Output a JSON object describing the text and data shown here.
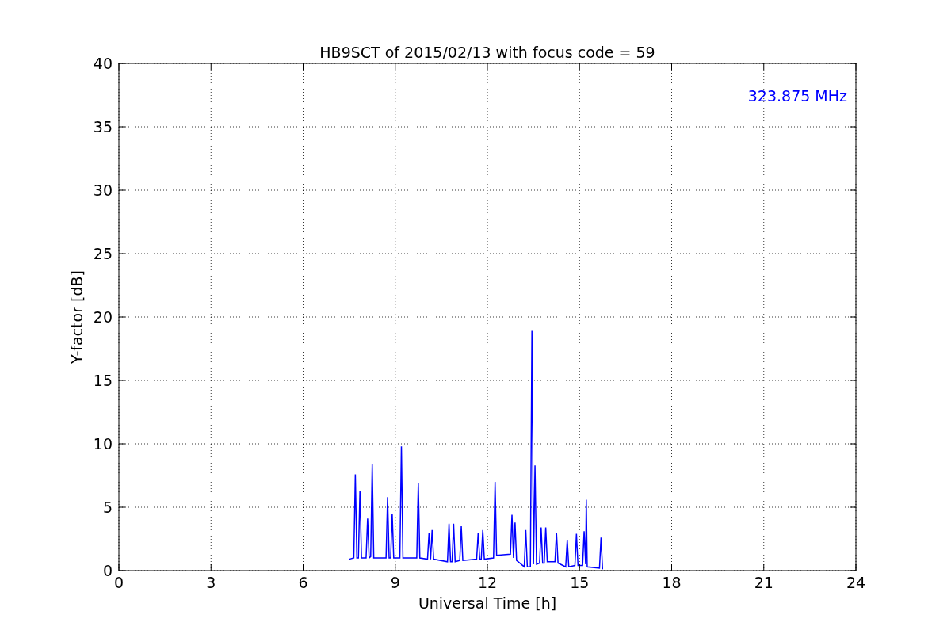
{
  "figure": {
    "chart_data": {
      "type": "line",
      "title": "HB9SCT of 2015/02/13 with focus code = 59",
      "xlabel": "Universal Time [h]",
      "ylabel": "Y-factor [dB]",
      "x": [
        7.5,
        7.65,
        7.7,
        7.75,
        7.8,
        7.85,
        7.9,
        8.05,
        8.1,
        8.15,
        8.2,
        8.25,
        8.3,
        8.7,
        8.75,
        8.8,
        8.85,
        8.9,
        8.95,
        9.15,
        9.2,
        9.25,
        9.7,
        9.75,
        9.8,
        10.05,
        10.1,
        10.15,
        10.2,
        10.25,
        10.7,
        10.75,
        10.8,
        10.85,
        10.9,
        10.95,
        11.1,
        11.15,
        11.2,
        11.65,
        11.7,
        11.75,
        11.8,
        11.85,
        11.9,
        12.2,
        12.25,
        12.3,
        12.75,
        12.8,
        12.85,
        12.9,
        12.95,
        13.2,
        13.25,
        13.3,
        13.4,
        13.45,
        13.5,
        13.55,
        13.6,
        13.7,
        13.75,
        13.8,
        13.85,
        13.9,
        13.95,
        14.2,
        14.25,
        14.3,
        14.55,
        14.6,
        14.65,
        14.85,
        14.9,
        14.95,
        15.1,
        15.15,
        15.2,
        15.22,
        15.25,
        15.65,
        15.7,
        15.75
      ],
      "series": [
        {
          "name": "323.875 MHz",
          "color": "#0000ff",
          "values": [
            0.9,
            1.0,
            7.6,
            1.0,
            1.0,
            6.3,
            1.0,
            1.0,
            4.1,
            1.0,
            1.1,
            8.4,
            1.0,
            1.0,
            5.8,
            1.0,
            1.0,
            4.5,
            1.0,
            1.0,
            9.8,
            1.0,
            1.0,
            6.9,
            1.0,
            0.9,
            3.0,
            0.9,
            3.2,
            0.9,
            0.7,
            3.7,
            0.7,
            0.7,
            3.7,
            0.7,
            0.8,
            3.5,
            0.8,
            0.9,
            3.0,
            0.9,
            0.9,
            3.2,
            0.9,
            1.0,
            7.0,
            1.2,
            1.3,
            4.4,
            1.0,
            3.8,
            0.8,
            0.3,
            3.2,
            0.3,
            0.3,
            18.9,
            0.5,
            8.3,
            0.5,
            0.6,
            3.4,
            0.6,
            0.6,
            3.4,
            0.7,
            0.7,
            3.0,
            0.6,
            0.3,
            2.4,
            0.3,
            0.4,
            2.9,
            0.4,
            0.4,
            3.1,
            0.5,
            5.6,
            0.3,
            0.2,
            2.6,
            0.1
          ]
        }
      ],
      "xlim": [
        0,
        24
      ],
      "ylim": [
        0,
        40
      ],
      "xticks": [
        0,
        3,
        6,
        9,
        12,
        15,
        18,
        21,
        24
      ],
      "yticks": [
        0,
        5,
        10,
        15,
        20,
        25,
        30,
        35,
        40
      ],
      "grid": true
    }
  }
}
